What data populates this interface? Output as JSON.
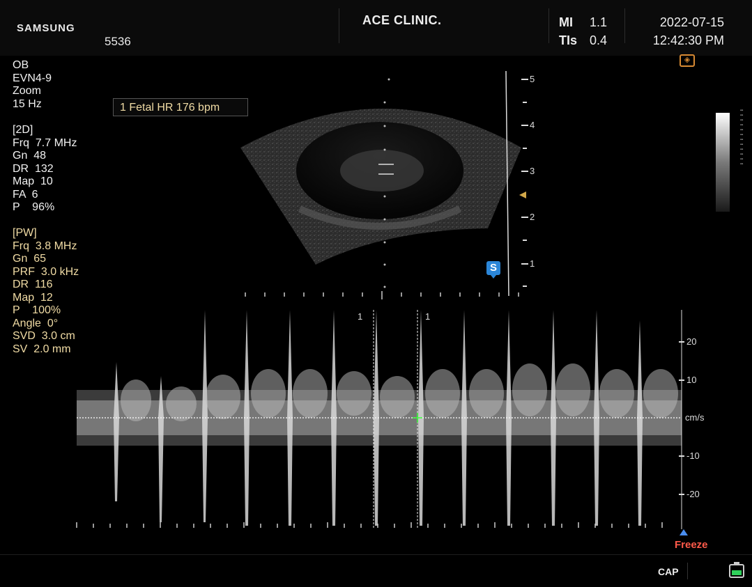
{
  "header": {
    "brand": "SAMSUNG",
    "patient_id": "5536",
    "clinic": "ACE CLINIC.",
    "mi_label": "MI",
    "mi_value": "1.1",
    "tis_label": "TIs",
    "tis_value": "0.4",
    "date": "2022-07-15",
    "time": "12:42:30 PM"
  },
  "general": [
    "OB",
    "EVN4-9",
    "Zoom",
    "15 Hz"
  ],
  "mode_2d": [
    "[2D]",
    "Frq  7.7 MHz",
    "Gn  48",
    "DR  132",
    "Map  10",
    "FA  6",
    "P    96%"
  ],
  "mode_pw": [
    "[PW]",
    "Frq  3.8 MHz",
    "Gn  65",
    "PRF  3.0 kHz",
    "DR  116",
    "Map  12",
    "P    100%",
    "Angle  0°",
    "SVD  3.0 cm",
    "SV  2.0 mm"
  ],
  "measurement": "1  Fetal HR  176 bpm",
  "depth_scale": [
    "5",
    "4",
    "3",
    "2",
    "1"
  ],
  "doppler_scale": [
    "20",
    "10",
    "cm/s",
    "-10",
    "-20"
  ],
  "doppler_cursor_labels": [
    "1",
    "1"
  ],
  "status": {
    "freeze": "Freeze",
    "cap": "CAP"
  },
  "icons": {
    "probe": "probe-orientation-icon",
    "sono_badge": "S",
    "battery": "battery-icon"
  },
  "colors": {
    "accent_yellow": "#f1dca5",
    "freeze_red": "#ff5a4a",
    "badge_blue": "#2b86d8"
  }
}
